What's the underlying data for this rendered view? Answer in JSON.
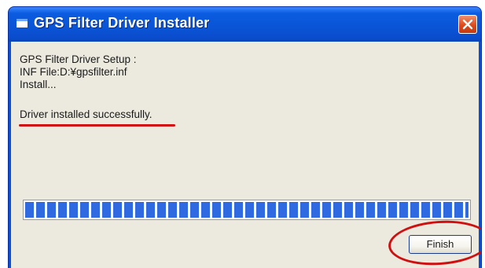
{
  "window": {
    "title": "GPS Filter Driver Installer"
  },
  "content": {
    "setup_line": "GPS Filter Driver Setup :",
    "inf_line": "INF File:D:¥gpsfilter.inf",
    "install_line": "Install...",
    "status_line": "Driver installed successfully."
  },
  "progress": {
    "value": 1.0
  },
  "buttons": {
    "finish_label": "Finish"
  },
  "icons": {
    "title": "window-app-icon",
    "close": "close-icon"
  },
  "colors": {
    "titlebar": "#0a54d6",
    "progress_fill": "#2f6ae0",
    "annotation": "#d01010",
    "client_bg": "#eceadf"
  }
}
